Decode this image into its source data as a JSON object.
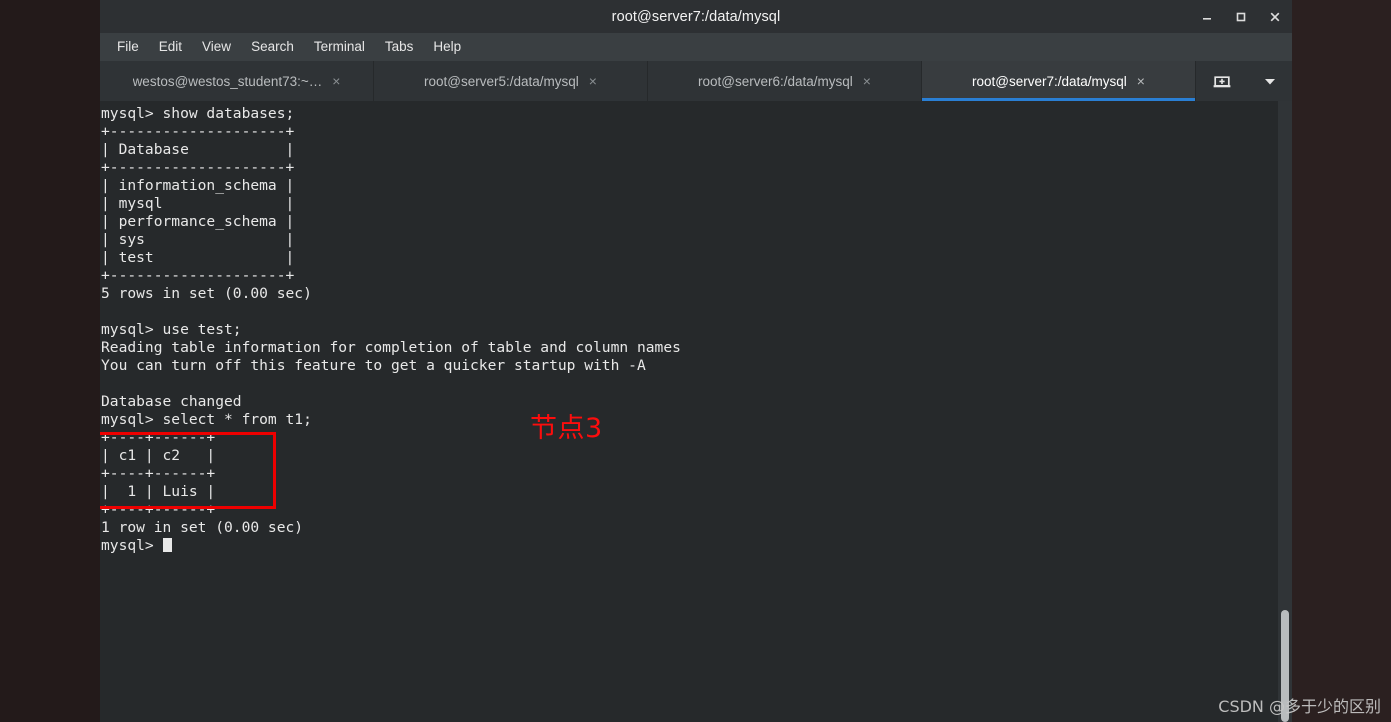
{
  "window": {
    "title": "root@server7:/data/mysql",
    "controls": {
      "minimize": "minimize-icon",
      "maximize": "maximize-icon",
      "close": "close-icon"
    }
  },
  "menubar": {
    "items": [
      {
        "label": "File"
      },
      {
        "label": "Edit"
      },
      {
        "label": "View"
      },
      {
        "label": "Search"
      },
      {
        "label": "Terminal"
      },
      {
        "label": "Tabs"
      },
      {
        "label": "Help"
      }
    ]
  },
  "tabbar": {
    "tabs": [
      {
        "label": "westos@westos_student73:~…",
        "close": "×",
        "active": false
      },
      {
        "label": "root@server5:/data/mysql",
        "close": "×",
        "active": false
      },
      {
        "label": "root@server6:/data/mysql",
        "close": "×",
        "active": false
      },
      {
        "label": "root@server7:/data/mysql",
        "close": "×",
        "active": true
      }
    ],
    "new_tab_icon": "new-tab-icon",
    "tab_menu_icon": "chevron-down-icon"
  },
  "terminal": {
    "lines_block_1": "mysql> show databases;\n+--------------------+\n| Database           |\n+--------------------+\n| information_schema |\n| mysql              |\n| performance_schema |\n| sys                |\n| test               |\n+--------------------+\n5 rows in set (0.00 sec)\n\nmysql> use test;\nReading table information for completion of table and column names\nYou can turn off this feature to get a quicker startup with -A\n\nDatabase changed\nmysql> select * from t1;\n+----+------+\n| c1 | c2   |\n+----+------+\n|  1 | Luis |\n+----+------+\n1 row in set (0.00 sec)\n",
    "prompt": "mysql> ",
    "cursor": "block-cursor"
  },
  "annotation": {
    "label": "节点3",
    "color": "#fc0d0d"
  },
  "watermark": {
    "text": "CSDN @多于少的区别"
  },
  "colors": {
    "desktop_bg": "#2b2020",
    "window_chrome": "#2d3033",
    "menubar_bg": "#3a3f42",
    "tabbar_bg": "#2f3336",
    "active_tab_bg": "#383c3f",
    "active_tab_underline": "#2a7fd4",
    "terminal_bg": "#26292b",
    "terminal_fg": "#e8e8e8",
    "annotation_red": "#ee0000"
  },
  "scrollbar": {
    "thumb_top_pct": 82,
    "thumb_height_pct": 18
  }
}
